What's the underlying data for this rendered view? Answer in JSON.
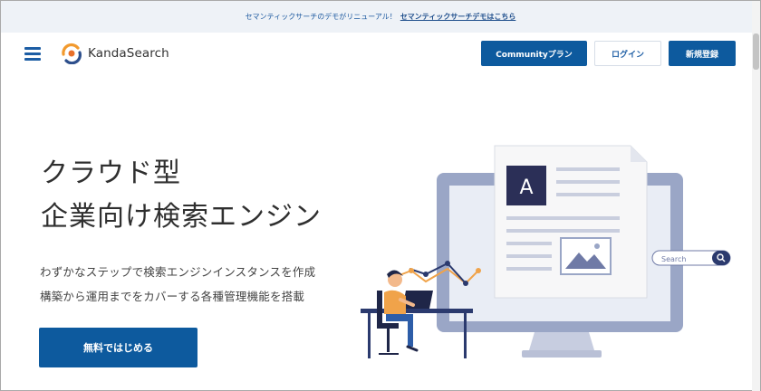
{
  "announcement": {
    "text": "セマンティックサーチのデモがリニューアル！",
    "link": "セマンティックサーチデモはこちら"
  },
  "header": {
    "logo_text": "KandaSearch",
    "community_label": "Communityプラン",
    "login_label": "ログイン",
    "signup_label": "新規登録"
  },
  "hero": {
    "title_line1": "クラウド型",
    "title_line2": "企業向け検索エンジン",
    "desc_line1": "わずかなステップで検索エンジンインスタンスを作成",
    "desc_line2": "構築から運用までをカバーする各種管理機能を搭載",
    "cta_label": "無料ではじめる",
    "search_placeholder": "Search",
    "doc_letter": "A"
  },
  "colors": {
    "primary": "#0d5a9e",
    "announce_bg": "#eef2f7",
    "monitor": "#9aa6c6",
    "doc_dark": "#2b2f57",
    "accent_orange": "#f0a34a"
  }
}
